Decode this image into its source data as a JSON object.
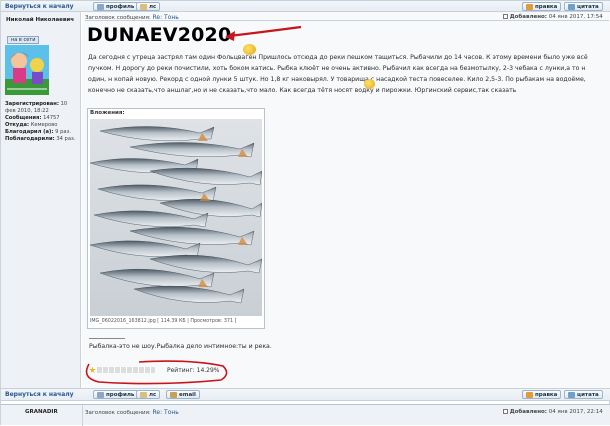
{
  "top_bar": {
    "back_link": "Вернуться к началу",
    "profile": "профиль",
    "pm": "лс",
    "edit": "правка",
    "quote": "цитата"
  },
  "author": {
    "name": "Николай Николаевич",
    "online": "на в сети",
    "details": [
      {
        "label": "Зарегистрирован:",
        "value": "10 фев 2010, 18:22"
      },
      {
        "label": "Сообщения:",
        "value": "14757"
      },
      {
        "label": "Откуда:",
        "value": "Кемерово"
      },
      {
        "label": "Благодарил (а):",
        "value": "9 раз."
      },
      {
        "label": "Поблагодарили:",
        "value": "34 раз."
      }
    ]
  },
  "post": {
    "subject_label": "Заголовок сообщения:",
    "subject": "Re: Тонь",
    "added_label": "Добавлено:",
    "added": "04 янв 2017, 17:54",
    "annotation": "DUNAEV2020",
    "text": "Да сегодня с утреца застрял там один Фольцваген  Пришлось отсюда до реки пешком тащиться. Рыбачили до 14 часов. К этому времени было уже всё пучком. Н дорогу до реки почистили, хоть боком катись. Рыбка клюёт не очень активно. Рыбачил как всегда на безмотылку, 2-3 чебака с лунки,а то н один, н копай новую. Рекорд с одной лунки 5 штук. Но 1,8 кг наковырял. У товарища с насадкой теста повеселее. Кило 2,5-3. По рыбакам на водоёме, конечно не сказать,что аншлаг,но и не сказать,что мало. Как всегда тётя носят водку и пирожки. Юргинский сервис,так сказать",
    "attachments_label": "Вложения:",
    "attachment_caption": "IMG_06022016_163812.jpg [ 114.39 КБ | Просмотров: 371 ]",
    "signature": "Рыбалка-это не шоу.Рыбалка дело интимное:ты и река.",
    "rating_label": "Рейтинг:",
    "rating_value": "14.29%",
    "rating_fraction": 0.14
  },
  "bottom_bar": {
    "back_link": "Вернуться к началу",
    "profile": "профиль",
    "pm": "лс",
    "email": "email",
    "edit": "правка",
    "quote": "цитата"
  },
  "next_post": {
    "author": "GRANADIR",
    "subject_label": "Заголовок сообщения:",
    "subject": "Re: Тонь",
    "added_label": "Добавлено:",
    "added": "04 янв 2017, 22:14"
  },
  "colors": {
    "link": "#28568f",
    "annotation_red": "#c8141b",
    "panel": "#eef2f6"
  }
}
